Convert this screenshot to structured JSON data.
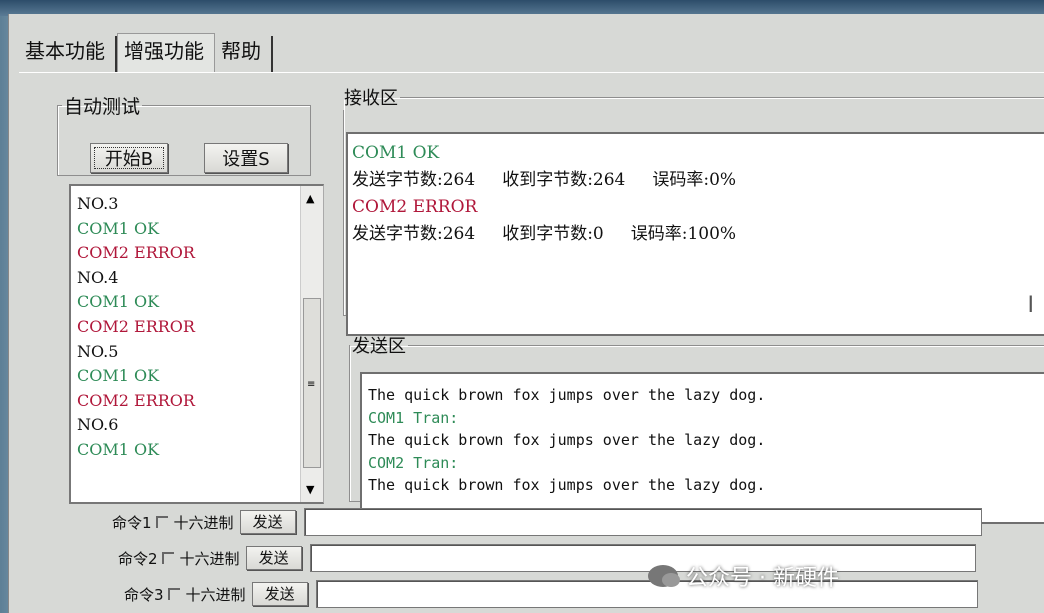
{
  "tabs": [
    {
      "label": "基本功能"
    },
    {
      "label": "增强功能",
      "active": true
    },
    {
      "label": "帮助"
    }
  ],
  "auto_test": {
    "title": "自动测试",
    "start_label": "开始B",
    "setup_label": "设置S"
  },
  "log_list": [
    {
      "text": "NO.3",
      "color": "black"
    },
    {
      "text": "COM1 OK",
      "color": "green"
    },
    {
      "text": "COM2 ERROR",
      "color": "red"
    },
    {
      "text": "NO.4",
      "color": "black"
    },
    {
      "text": "COM1 OK",
      "color": "green"
    },
    {
      "text": "COM2 ERROR",
      "color": "red"
    },
    {
      "text": "NO.5",
      "color": "black"
    },
    {
      "text": "COM1 OK",
      "color": "green"
    },
    {
      "text": "COM2 ERROR",
      "color": "red"
    },
    {
      "text": "NO.6",
      "color": "black"
    },
    {
      "text": "COM1 OK",
      "color": "green"
    }
  ],
  "receive": {
    "title": "接收区",
    "lines": [
      {
        "text": "COM1 OK",
        "color": "green"
      },
      {
        "text": "发送字节数:264     收到字节数:264     误码率:0%",
        "color": "black"
      },
      {
        "text": "COM2 ERROR",
        "color": "red"
      },
      {
        "text": "发送字节数:264     收到字节数:0     误码率:100%",
        "color": "black"
      }
    ]
  },
  "send": {
    "title": "发送区",
    "lines": [
      {
        "text": "The quick brown fox jumps over the lazy dog.",
        "color": "black"
      },
      {
        "text": "COM1 Tran:",
        "color": "green"
      },
      {
        "text": "The quick brown fox jumps over the lazy dog.",
        "color": "black"
      },
      {
        "text": "COM2 Tran:",
        "color": "green"
      },
      {
        "text": "The quick brown fox jumps over the lazy dog.",
        "color": "black"
      }
    ]
  },
  "commands": [
    {
      "label": "命令1",
      "hex_label": "十六进制",
      "send_label": "发送"
    },
    {
      "label": "命令2",
      "hex_label": "十六进制",
      "send_label": "发送"
    },
    {
      "label": "命令3",
      "hex_label": "十六进制",
      "send_label": "发送"
    }
  ],
  "watermark": "公众号 · 新硬件"
}
